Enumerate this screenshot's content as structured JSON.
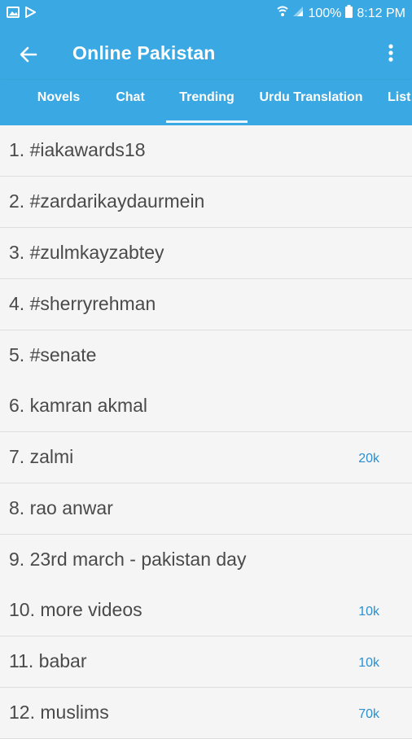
{
  "status": {
    "battery": "100%",
    "time": "8:12 PM"
  },
  "app": {
    "title": "Online Pakistan"
  },
  "tabs": [
    "Novels",
    "Chat",
    "Trending",
    "Urdu Translation",
    "List"
  ],
  "active_tab": "Trending",
  "accent_color": "#3aa9e3",
  "badge_color": "#2b8fd0",
  "items": [
    {
      "label": "1. #iakawards18",
      "badge": ""
    },
    {
      "label": "2. #zardarikaydaurmein",
      "badge": ""
    },
    {
      "label": "3. #zulmkayzabtey",
      "badge": ""
    },
    {
      "label": "4. #sherryrehman",
      "badge": ""
    },
    {
      "label": "5. #senate",
      "badge": ""
    },
    {
      "label": "6. kamran akmal",
      "badge": ""
    },
    {
      "label": "7. zalmi",
      "badge": "20k"
    },
    {
      "label": "8. rao anwar",
      "badge": ""
    },
    {
      "label": "9. 23rd march - pakistan day",
      "badge": ""
    },
    {
      "label": "10. more videos",
      "badge": "10k"
    },
    {
      "label": "11. babar",
      "badge": "10k"
    },
    {
      "label": "12. muslims",
      "badge": "70k"
    }
  ]
}
